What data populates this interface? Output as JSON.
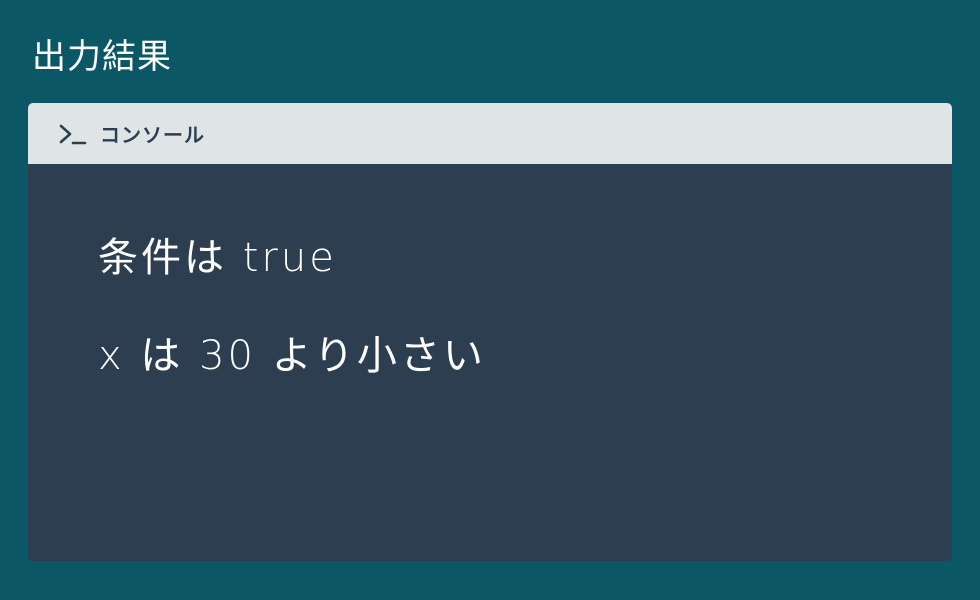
{
  "page": {
    "title": "出力結果"
  },
  "console": {
    "header_label": "コンソール",
    "icon": "terminal-icon",
    "lines": [
      "条件は true",
      "x は 30 より小さい"
    ]
  },
  "colors": {
    "background": "#0b5766",
    "panel": "#2c3e50",
    "header": "#dfe4e7",
    "text": "#ffffff"
  }
}
